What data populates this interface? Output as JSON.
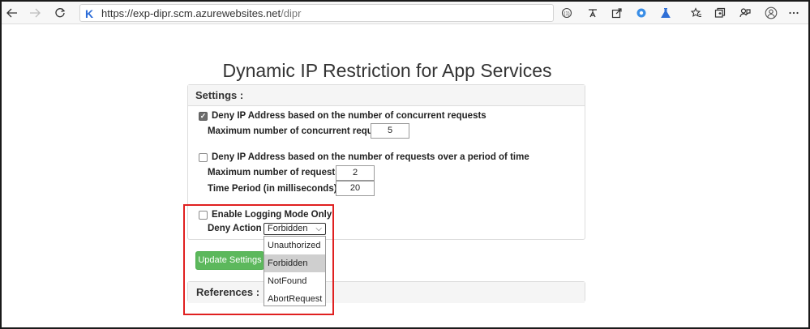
{
  "browser": {
    "url_host": "https://exp-dipr.scm.azurewebsites.net",
    "url_path": "/dipr",
    "site_icon_letter": "K",
    "toolbar_icons": [
      "back-icon",
      "forward-icon",
      "refresh-icon",
      "site-logo-icon",
      "reader-icon",
      "translate-icon",
      "share-icon",
      "extension-icon",
      "flask-icon",
      "favorites-icon",
      "collections-icon",
      "feedback-icon",
      "profile-icon",
      "more-icon"
    ]
  },
  "page": {
    "title": "Dynamic IP Restriction for App Services"
  },
  "settings": {
    "heading": "Settings :",
    "concurrent": {
      "checked": true,
      "label": "Deny IP Address based on the number of concurrent requests",
      "max_label": "Maximum number of concurrent requests:",
      "max_value": "5"
    },
    "rate": {
      "checked": false,
      "label": "Deny IP Address based on the number of requests over a period of time",
      "max_label": "Maximum number of requests :",
      "max_value": "2",
      "period_label": "Time Period (in milliseconds) :",
      "period_value": "20"
    },
    "logging": {
      "checked": false,
      "label": "Enable Logging Mode Only"
    },
    "deny_action": {
      "label": "Deny Action :",
      "selected": "Forbidden",
      "options": [
        "Unauthorized",
        "Forbidden",
        "NotFound",
        "AbortRequest"
      ]
    }
  },
  "update_button": "Update Settings",
  "references": {
    "heading": "References :"
  },
  "colors": {
    "button_green": "#5cb85c",
    "highlight_red": "#e02020",
    "link_blue": "#2b6cd8"
  }
}
